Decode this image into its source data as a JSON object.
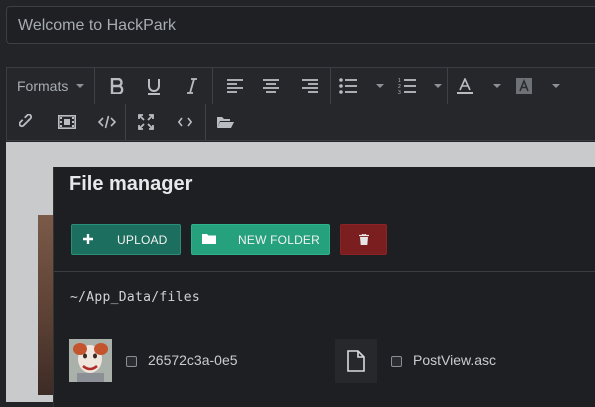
{
  "page": {
    "title_value": "Welcome to HackPark"
  },
  "toolbar": {
    "formats_label": "Formats",
    "buttons": [
      "bold",
      "underline",
      "italic",
      "align-left",
      "align-center",
      "align-right",
      "bullet-list",
      "numbered-list",
      "text-color",
      "background-color",
      "link",
      "media",
      "source-code",
      "fullscreen",
      "code",
      "file-manager"
    ]
  },
  "file_manager": {
    "title": "File manager",
    "upload_label": "UPLOAD",
    "new_folder_label": "NEW FOLDER",
    "path": "~/App_Data/files",
    "files": [
      {
        "name": "26572c3a-0e5",
        "type": "image"
      },
      {
        "name": "PostView.asc",
        "type": "document"
      }
    ]
  },
  "colors": {
    "upload": "#1c6e5e",
    "new_folder": "#26a17d",
    "delete": "#7a1e20"
  }
}
